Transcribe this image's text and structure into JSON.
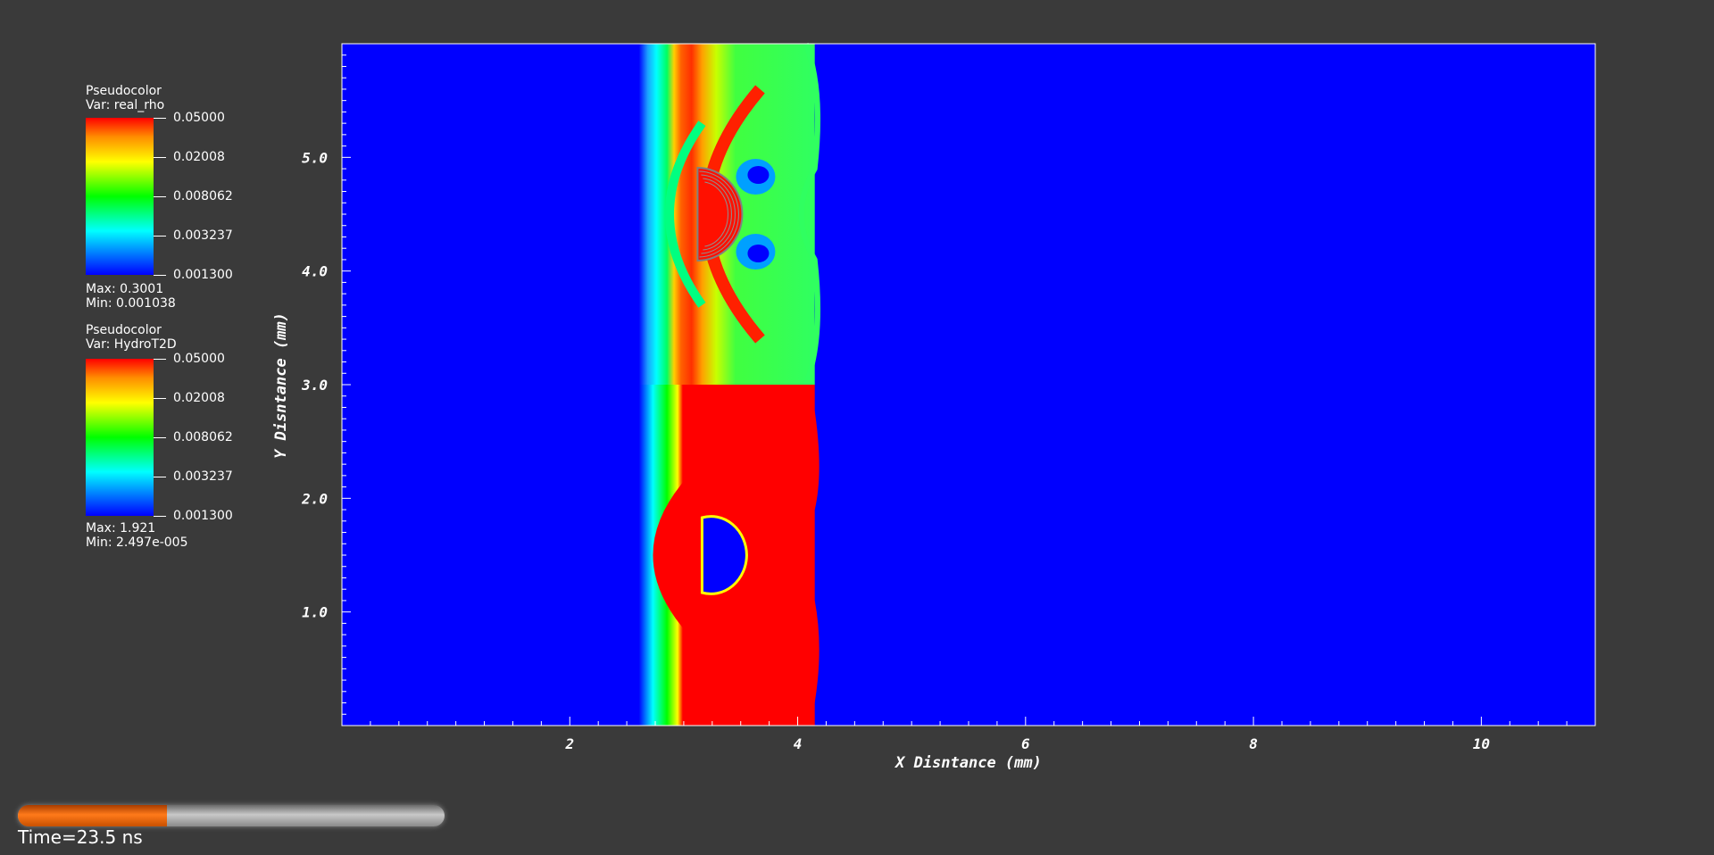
{
  "legends": [
    {
      "title": "Pseudocolor",
      "var": "Var: real_rho",
      "ticks": [
        "0.05000",
        "0.02008",
        "0.008062",
        "0.003237",
        "0.001300"
      ],
      "max": "Max:  0.3001",
      "min": "Min:  0.001038"
    },
    {
      "title": "Pseudocolor",
      "var": "Var: HydroT2D",
      "ticks": [
        "0.05000",
        "0.02008",
        "0.008062",
        "0.003237",
        "0.001300"
      ],
      "max": "Max:  1.921",
      "min": "Min:  2.497e-005"
    }
  ],
  "chart_data": {
    "type": "heatmap",
    "xlabel": "X Disntance (mm)",
    "ylabel": "Y Disntance (mm)",
    "xlim": [
      0,
      11
    ],
    "ylim": [
      0,
      6
    ],
    "x_ticks": [
      2,
      4,
      6,
      8,
      10
    ],
    "x_tick_labels": [
      "2",
      "4",
      "6",
      "8",
      "10"
    ],
    "y_ticks": [
      1,
      2,
      3,
      4,
      5
    ],
    "y_tick_labels": [
      "1.0",
      "2.0",
      "3.0",
      "4.0",
      "5.0"
    ],
    "colormap": [
      "#0000ff",
      "#00ffff",
      "#00ff00",
      "#ffff00",
      "#ff0000"
    ],
    "panels": [
      {
        "variable": "real_rho",
        "y_range": [
          3,
          6
        ],
        "bubble_center": [
          3.2,
          4.5
        ]
      },
      {
        "variable": "HydroT2D",
        "y_range": [
          0,
          3
        ],
        "bubble_center": [
          3.2,
          1.5
        ]
      }
    ],
    "shock_front_x": 4.15,
    "material_left_x": 2.7
  },
  "time_slider": {
    "fraction": 0.35,
    "label": "Time=23.5 ns"
  },
  "colors": {
    "background": "#3a3a3a",
    "field": "#0000ff",
    "hot": "#ff0000"
  }
}
